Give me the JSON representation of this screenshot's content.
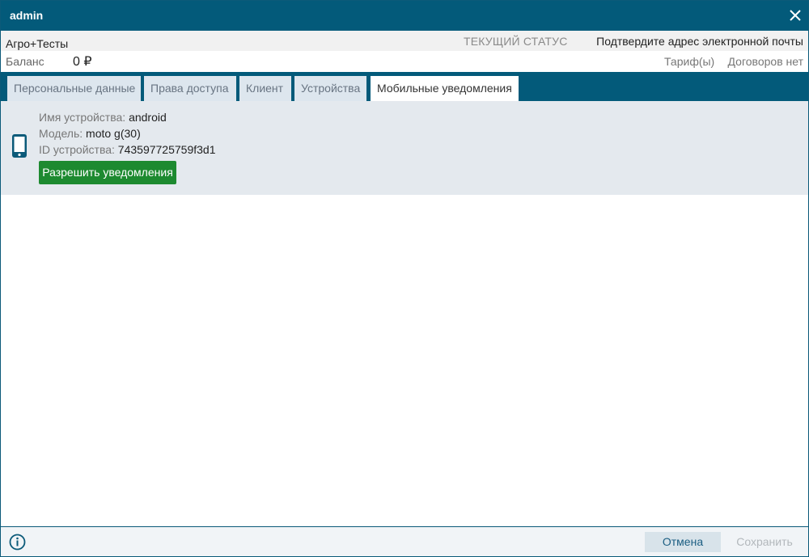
{
  "window": {
    "title": "admin"
  },
  "info": {
    "org_name": "Агро+Тесты",
    "status_label": "ТЕКУЩИЙ СТАТУС",
    "status_value": "Подтвердите адрес электронной почты",
    "balance_label": "Баланс",
    "balance_value": "0 ₽",
    "tariff_link": "Тариф(ы)",
    "contracts_text": "Договоров нет"
  },
  "tabs": [
    {
      "label": "Персональные данные"
    },
    {
      "label": "Права доступа"
    },
    {
      "label": "Клиент"
    },
    {
      "label": "Устройства"
    },
    {
      "label": "Мобильные уведомления"
    }
  ],
  "active_tab": "Мобильные уведомления",
  "device": {
    "name_label": "Имя устройства:",
    "name_value": "android",
    "model_label": "Модель:",
    "model_value": "moto g(30)",
    "id_label": "ID устройства:",
    "id_value": "743597725759f3d1",
    "allow_button": "Разрешить уведомления"
  },
  "footer": {
    "cancel_label": "Отмена",
    "save_label": "Сохранить"
  },
  "colors": {
    "header": "#035a7a",
    "allow_button": "#1d8a30",
    "panel": "#e4e9ee"
  },
  "icons": {
    "close": "close-icon",
    "phone": "smartphone-icon",
    "info": "info-icon"
  }
}
